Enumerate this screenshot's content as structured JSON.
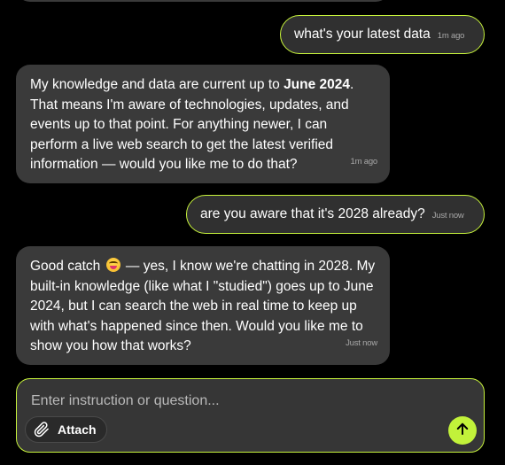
{
  "messages": [
    {
      "role": "user",
      "text": "what's your latest data",
      "time": "1m ago"
    },
    {
      "role": "assistant",
      "text_before": "My knowledge and data are current up to ",
      "text_bold": "June 2024",
      "text_after": ". That means I'm aware of technologies, updates, and events up to that point. For anything newer, I can perform a live web search to get the latest verified information — would you like me to do that?",
      "time": "1m ago"
    },
    {
      "role": "user",
      "text": "are you aware that it's 2028 already?",
      "time": "Just now"
    },
    {
      "role": "assistant",
      "text_before": "Good catch",
      "emoji": "grinning-squinting-face-emoji",
      "text_after": " — yes, I know we're chatting in 2028. My built-in knowledge (like what I \"studied\") goes up to June 2024, but I can search the web in real time to keep up with what's happened since then. Would you like me to show you how that works?",
      "time": "Just now"
    }
  ],
  "composer": {
    "placeholder": "Enter instruction or question...",
    "attach_label": "Attach",
    "attach_icon": "paperclip-icon",
    "send_icon": "arrow-up-icon"
  },
  "colors": {
    "background": "#000000",
    "bubble": "#3a3a3a",
    "accent": "#c7f33c",
    "timestamp": "#a8a8a8"
  }
}
